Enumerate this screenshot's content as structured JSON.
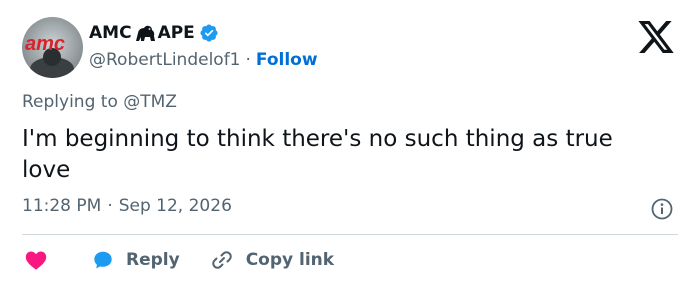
{
  "author": {
    "display_name_start": "AMC",
    "display_name_end": "APE",
    "ape_emoji": "gorilla-icon",
    "verified": "verified-badge-icon",
    "handle": "@RobertLindelof1",
    "separator": "·",
    "follow_label": "Follow",
    "avatar_text": "amc"
  },
  "reply_context": {
    "prefix": "Replying to",
    "mention": "@TMZ"
  },
  "tweet": {
    "text": "I'm beginning to think there's no such thing as true\nlove"
  },
  "meta": {
    "time": "11:28 PM",
    "separator": "·",
    "date": "Sep 12, 2026"
  },
  "actions": {
    "like_icon": "heart-icon",
    "reply_label": "Reply",
    "copy_label": "Copy link"
  },
  "colors": {
    "accent": "#1d9bf0",
    "follow": "#006fd6",
    "like": "#f91880",
    "muted": "#536471",
    "text": "#0f1419"
  }
}
